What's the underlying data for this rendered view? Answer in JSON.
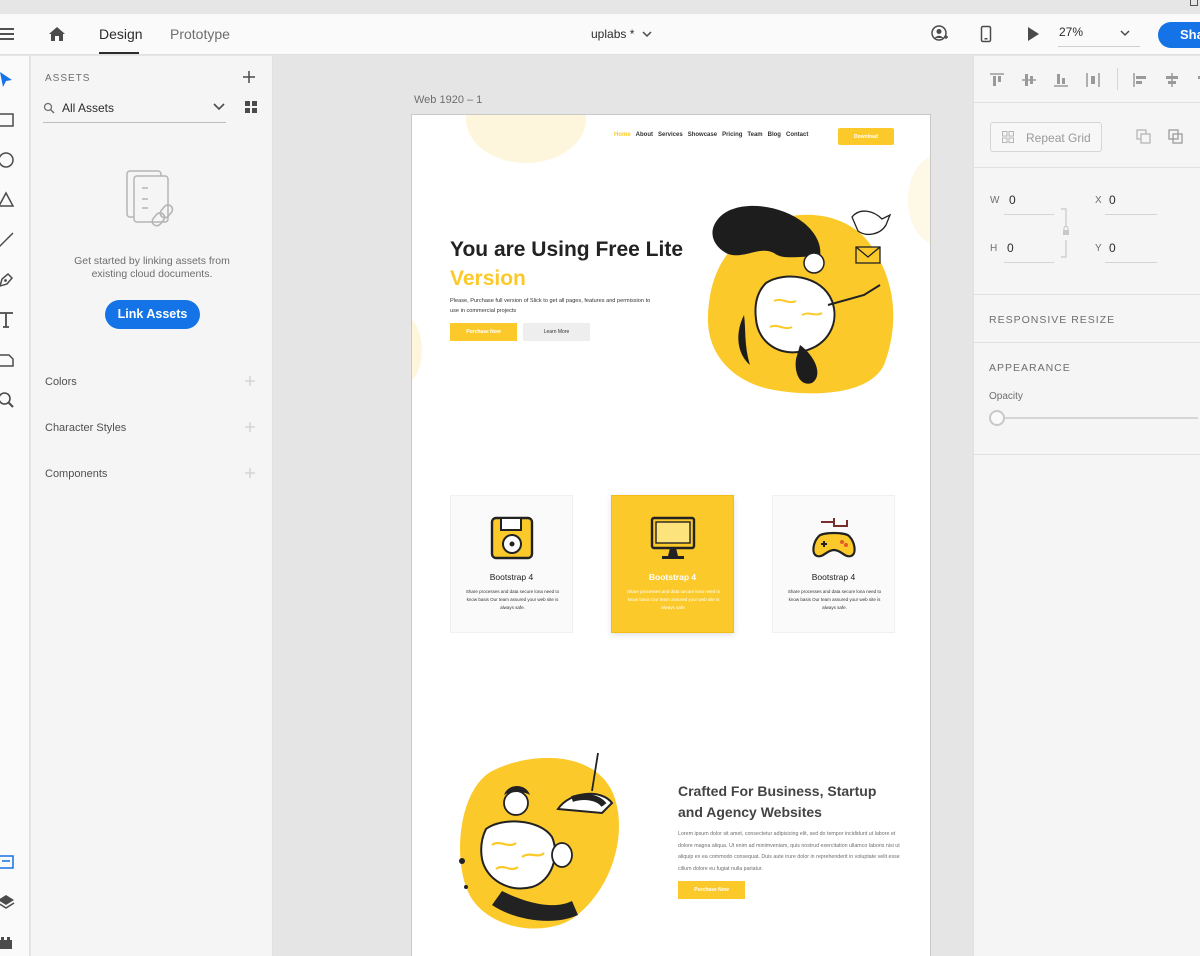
{
  "app": {
    "tabs": [
      "Design",
      "Prototype"
    ],
    "active_tab": "Design",
    "document_title": "uplabs *",
    "zoom": "27%",
    "share_label": "Share"
  },
  "colors": {
    "accent": "#1473e6",
    "brand_yellow": "#fbca2a"
  },
  "tools": [
    "select-tool-icon",
    "rectangle-tool-icon",
    "ellipse-tool-icon",
    "polygon-tool-icon",
    "line-tool-icon",
    "pen-tool-icon",
    "text-tool-icon",
    "artboard-tool-icon",
    "zoom-tool-icon",
    "assets-panel-icon",
    "layers-panel-icon",
    "plugins-panel-icon"
  ],
  "assets": {
    "title": "ASSETS",
    "filter": "All Assets",
    "empty_message": "Get started by linking assets from existing cloud documents.",
    "link_button": "Link Assets",
    "sections": [
      "Colors",
      "Character Styles",
      "Components"
    ]
  },
  "canvas": {
    "artboard_label": "Web 1920 – 1",
    "nav": [
      "Home",
      "About",
      "Services",
      "Showcase",
      "Pricing",
      "Team",
      "Blog",
      "Contact"
    ],
    "download_label": "Download",
    "hero": {
      "title_line1": "You are Using Free Lite",
      "title_line2": "Version",
      "text": "Please, Purchase full version of Slick to get all pages, features and permission to use in commercial projects",
      "primary_button": "Purchase Now",
      "secondary_button": "Learn More"
    },
    "features": [
      {
        "title": "Bootstrap 4",
        "text": "Share processes and data secure lona need to know basis Our team assured your web site is always safe.",
        "icon": "floppy-disk-icon",
        "highlighted": false
      },
      {
        "title": "Bootstrap 4",
        "text": "Share processes and data secure lona need to know basis Our team assured your web site is always safe.",
        "icon": "monitor-icon",
        "highlighted": true
      },
      {
        "title": "Bootstrap 4",
        "text": "Share processes and data secure lona need to know basis Our team assured your web site is always safe.",
        "icon": "gamepad-icon",
        "highlighted": false
      }
    ],
    "about": {
      "title": "Crafted For Business, Startup and Agency Websites",
      "text": "Lorem ipsum dolor sit amet, consectetur adipisicing elit, sed do tempor incididunt ut labore et dolore magna aliqua. Ut enim ad minimveniam, quis nostrud exercitation ullamco laboris nisi ut aliquip ex ea commodo consequat. Duis aute irure dolor in reprehenderit in voluptate velit esse cillum dolore eu fugiat nulla pariatur.",
      "button": "Purchase Now"
    }
  },
  "inspector": {
    "repeat_grid": "Repeat Grid",
    "w_label": "W",
    "w_value": "0",
    "h_label": "H",
    "h_value": "0",
    "x_label": "X",
    "x_value": "0",
    "y_label": "Y",
    "y_value": "0",
    "responsive_resize": "RESPONSIVE RESIZE",
    "appearance": "APPEARANCE",
    "opacity_label": "Opacity",
    "opacity_value": 0
  }
}
